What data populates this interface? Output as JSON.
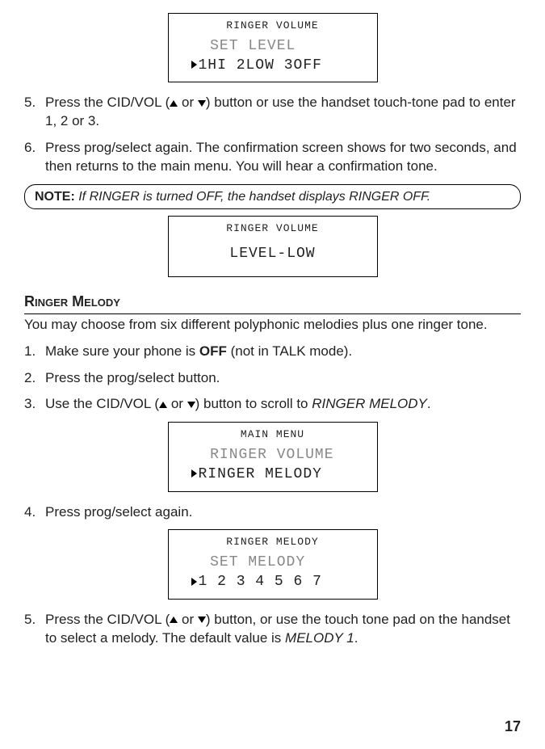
{
  "lcd1": {
    "title": "RINGER VOLUME",
    "line1": "SET LEVEL",
    "line2": "1HI 2LOW 3OFF"
  },
  "steps_a": {
    "s5_pre": "Press the CID/VOL (",
    "s5_mid": " or ",
    "s5_post": ") button or use the handset touch-tone pad to enter 1, 2 or 3.",
    "s6": "Press prog/select again. The confirmation screen shows for two seconds, and then returns to the main menu. You will hear a confirmation tone."
  },
  "note": {
    "label": "NOTE:",
    "text": " If RINGER is turned OFF, the handset displays ",
    "ital": "RINGER OFF."
  },
  "lcd2": {
    "title": "RINGER VOLUME",
    "line": "LEVEL-LOW"
  },
  "section": {
    "heading": "Ringer Melody",
    "intro": "You may choose from six different polyphonic melodies plus one ringer tone."
  },
  "steps_b": {
    "s1_pre": "Make sure your phone is ",
    "s1_bold": "OFF",
    "s1_post": " (not in TALK mode).",
    "s2": "Press the prog/select button.",
    "s3_pre": "Use the CID/VOL (",
    "s3_mid": " or ",
    "s3_post": ") button to scroll to ",
    "s3_ital": "RINGER MELODY",
    "s3_end": ".",
    "s4": "Press prog/select again.",
    "s5_pre": "Press the CID/VOL (",
    "s5_mid": " or ",
    "s5_post": ") button, or use the touch tone pad on the handset to select a melody. The default value is ",
    "s5_ital": "MELODY 1",
    "s5_end": "."
  },
  "lcd3": {
    "title": "MAIN MENU",
    "line1": "RINGER VOLUME",
    "line2": "RINGER MELODY"
  },
  "lcd4": {
    "title": "RINGER MELODY",
    "line1": "SET MELODY",
    "line2": "1 2 3 4 5 6 7"
  },
  "page": "17"
}
